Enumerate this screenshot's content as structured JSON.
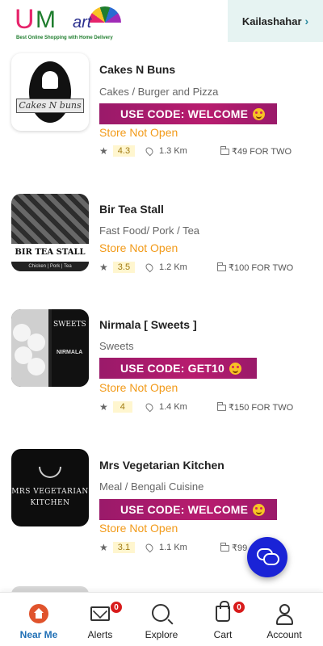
{
  "header": {
    "logo_text": {
      "u": "U",
      "m": "M",
      "art": "art",
      "tagline": "Best Online Shopping with Home Delivery"
    },
    "location": "Kailashahar",
    "location_chevron": "›"
  },
  "stores": [
    {
      "name": "Cakes N Buns",
      "category": "Cakes / Burger and Pizza",
      "coupon": "USE CODE: WELCOME",
      "status": "Store Not Open",
      "rating": "4.3",
      "distance": "1.3 Km",
      "price": "₹49 FOR TWO",
      "thumb_text": "Cakes N buns"
    },
    {
      "name": "Bir Tea Stall",
      "category": "Fast Food/ Pork / Tea",
      "coupon": "",
      "status": "Store Not Open",
      "rating": "3.5",
      "distance": "1.2 Km",
      "price": "₹100 FOR TWO",
      "thumb_text": "BIR TEA STALL",
      "thumb_sub": "Chicken | Pork | Tea"
    },
    {
      "name": "Nirmala [ Sweets ]",
      "category": "Sweets",
      "coupon": "USE CODE: GET10",
      "status": "Store Not Open",
      "rating": "4",
      "distance": "1.4 Km",
      "price": "₹150 FOR TWO",
      "thumb_text": "SWEETS",
      "thumb_sub": "NIRMALA"
    },
    {
      "name": "Mrs Vegetarian Kitchen",
      "category": "Meal / Bengali Cuisine",
      "coupon": "USE CODE: WELCOME",
      "status": "Store Not Open",
      "rating": "3.1",
      "distance": "1.1 Km",
      "price": "₹99",
      "thumb_text": "MRS VEGETARIAN",
      "thumb_sub": "KITCHEN"
    }
  ],
  "nav": {
    "items": [
      {
        "label": "Near Me"
      },
      {
        "label": "Alerts",
        "badge": "0"
      },
      {
        "label": "Explore"
      },
      {
        "label": "Cart",
        "badge": "0"
      },
      {
        "label": "Account"
      }
    ]
  },
  "colors": {
    "coupon": "#b81c6e",
    "status": "#f29a18",
    "nav_active": "#1f6fb5",
    "fab": "#1a23d6"
  }
}
